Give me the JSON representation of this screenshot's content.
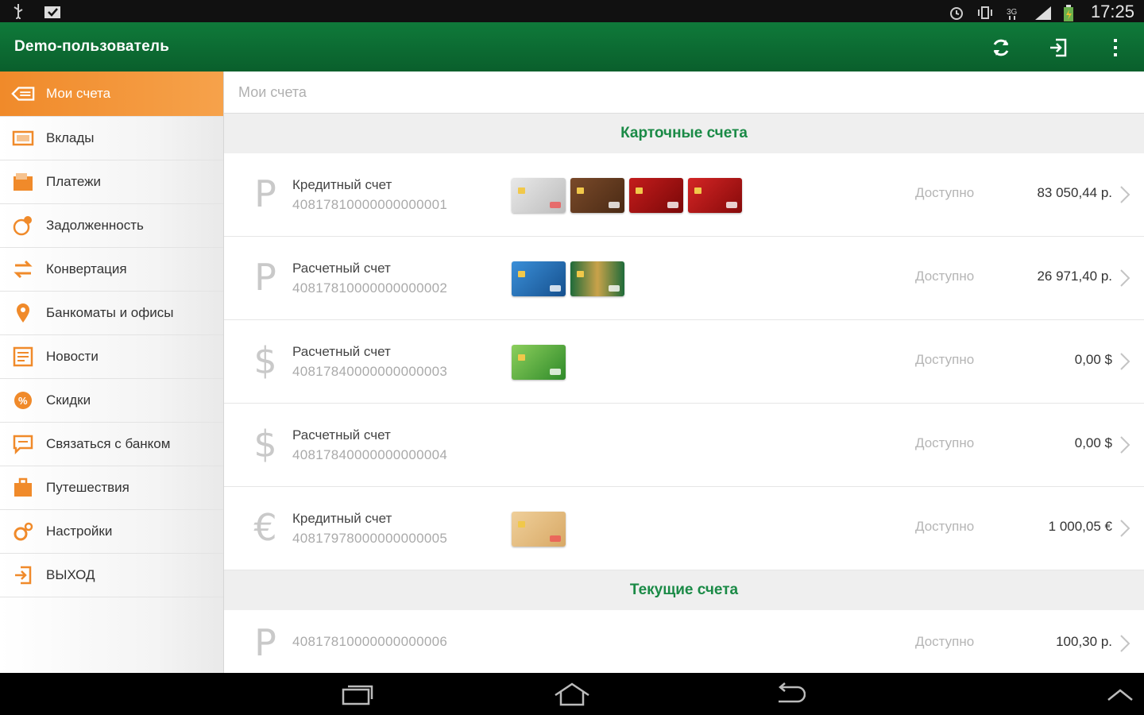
{
  "status_bar": {
    "time": "17:25"
  },
  "action_bar": {
    "title": "Demo-пользователь"
  },
  "sidebar": {
    "items": [
      {
        "label": "Мои счета",
        "icon": "wallet-icon",
        "active": true
      },
      {
        "label": "Вклады",
        "icon": "deposit-icon"
      },
      {
        "label": "Платежи",
        "icon": "payments-icon"
      },
      {
        "label": "Задолженность",
        "icon": "debt-icon"
      },
      {
        "label": "Конвертация",
        "icon": "exchange-icon"
      },
      {
        "label": "Банкоматы и офисы",
        "icon": "map-pin-icon"
      },
      {
        "label": "Новости",
        "icon": "news-icon"
      },
      {
        "label": "Скидки",
        "icon": "discount-icon"
      },
      {
        "label": "Связаться с банком",
        "icon": "chat-icon"
      },
      {
        "label": "Путешествия",
        "icon": "suitcase-icon"
      },
      {
        "label": "Настройки",
        "icon": "settings-icon"
      },
      {
        "label": "ВЫХОД",
        "icon": "logout-icon"
      }
    ]
  },
  "main": {
    "breadcrumb": "Мои счета",
    "sections": [
      {
        "title": "Карточные счета",
        "accounts": [
          {
            "currency_symbol": "Р",
            "name": "Кредитный счет",
            "number": "40817810000000000001",
            "available_label": "Доступно",
            "amount": "83 050,44 р.",
            "cards": [
              "silver",
              "brown",
              "red",
              "red"
            ]
          },
          {
            "currency_symbol": "Р",
            "name": "Расчетный счет",
            "number": "40817810000000000002",
            "available_label": "Доступно",
            "amount": "26 971,40 р.",
            "cards": [
              "blue",
              "green-dark"
            ]
          },
          {
            "currency_symbol": "$",
            "name": "Расчетный счет",
            "number": "40817840000000000003",
            "available_label": "Доступно",
            "amount": "0,00 $",
            "cards": [
              "green"
            ]
          },
          {
            "currency_symbol": "$",
            "name": "Расчетный счет",
            "number": "40817840000000000004",
            "available_label": "Доступно",
            "amount": "0,00 $",
            "cards": []
          },
          {
            "currency_symbol": "€",
            "name": "Кредитный счет",
            "number": "40817978000000000005",
            "available_label": "Доступно",
            "amount": "1 000,05 €",
            "cards": [
              "gold"
            ]
          }
        ]
      },
      {
        "title": "Текущие счета",
        "accounts": [
          {
            "currency_symbol": "Р",
            "name": "",
            "number": "40817810000000000006",
            "available_label": "Доступно",
            "amount": "100,30 р.",
            "cards": []
          }
        ]
      }
    ]
  },
  "colors": {
    "action_bar": "#0f7a3a",
    "active_item": "#f08a2a",
    "section_title": "#1a8a46"
  }
}
